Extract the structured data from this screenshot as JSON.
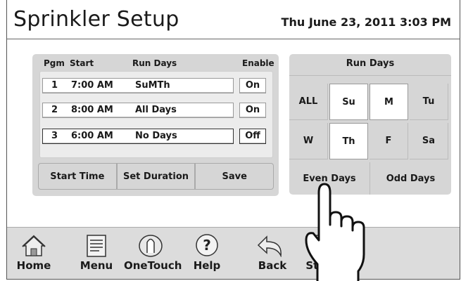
{
  "header": {
    "title": "Sprinkler Setup",
    "datetime": "Thu June 23, 2011  3:03 PM"
  },
  "programs": {
    "columns": {
      "pgm": "Pgm",
      "start": "Start",
      "run_days": "Run Days",
      "enable": "Enable"
    },
    "rows": [
      {
        "pgm": "1",
        "start": "7:00 AM",
        "run_days": "SuMTh",
        "enable": "On"
      },
      {
        "pgm": "2",
        "start": "8:00 AM",
        "run_days": "All Days",
        "enable": "On"
      },
      {
        "pgm": "3",
        "start": "6:00 AM",
        "run_days": "No Days",
        "enable": "Off"
      }
    ],
    "selected_row": 3,
    "actions": {
      "start_time": "Start Time",
      "set_duration": "Set Duration",
      "save": "Save"
    }
  },
  "run_days": {
    "title": "Run Days",
    "buttons": [
      {
        "label": "ALL",
        "active": false
      },
      {
        "label": "Su",
        "active": true
      },
      {
        "label": "M",
        "active": true
      },
      {
        "label": "Tu",
        "active": false
      },
      {
        "label": "W",
        "active": false
      },
      {
        "label": "Th",
        "active": true
      },
      {
        "label": "F",
        "active": false
      },
      {
        "label": "Sa",
        "active": false
      }
    ],
    "even_days": "Even Days",
    "odd_days": "Odd Days"
  },
  "nav": {
    "items": [
      {
        "label": "Home",
        "icon": "home-icon"
      },
      {
        "label": "Menu",
        "icon": "menu-icon"
      },
      {
        "label": "OneTouch",
        "icon": "onetouch-icon"
      },
      {
        "label": "Help",
        "icon": "help-icon"
      },
      {
        "label": "Back",
        "icon": "back-icon"
      },
      {
        "label": "Stat",
        "icon": "status-icon"
      }
    ]
  },
  "colors": {
    "panel": "#d6d6d6",
    "nav": "#dcdcdc",
    "active_day": "#ffffff"
  }
}
